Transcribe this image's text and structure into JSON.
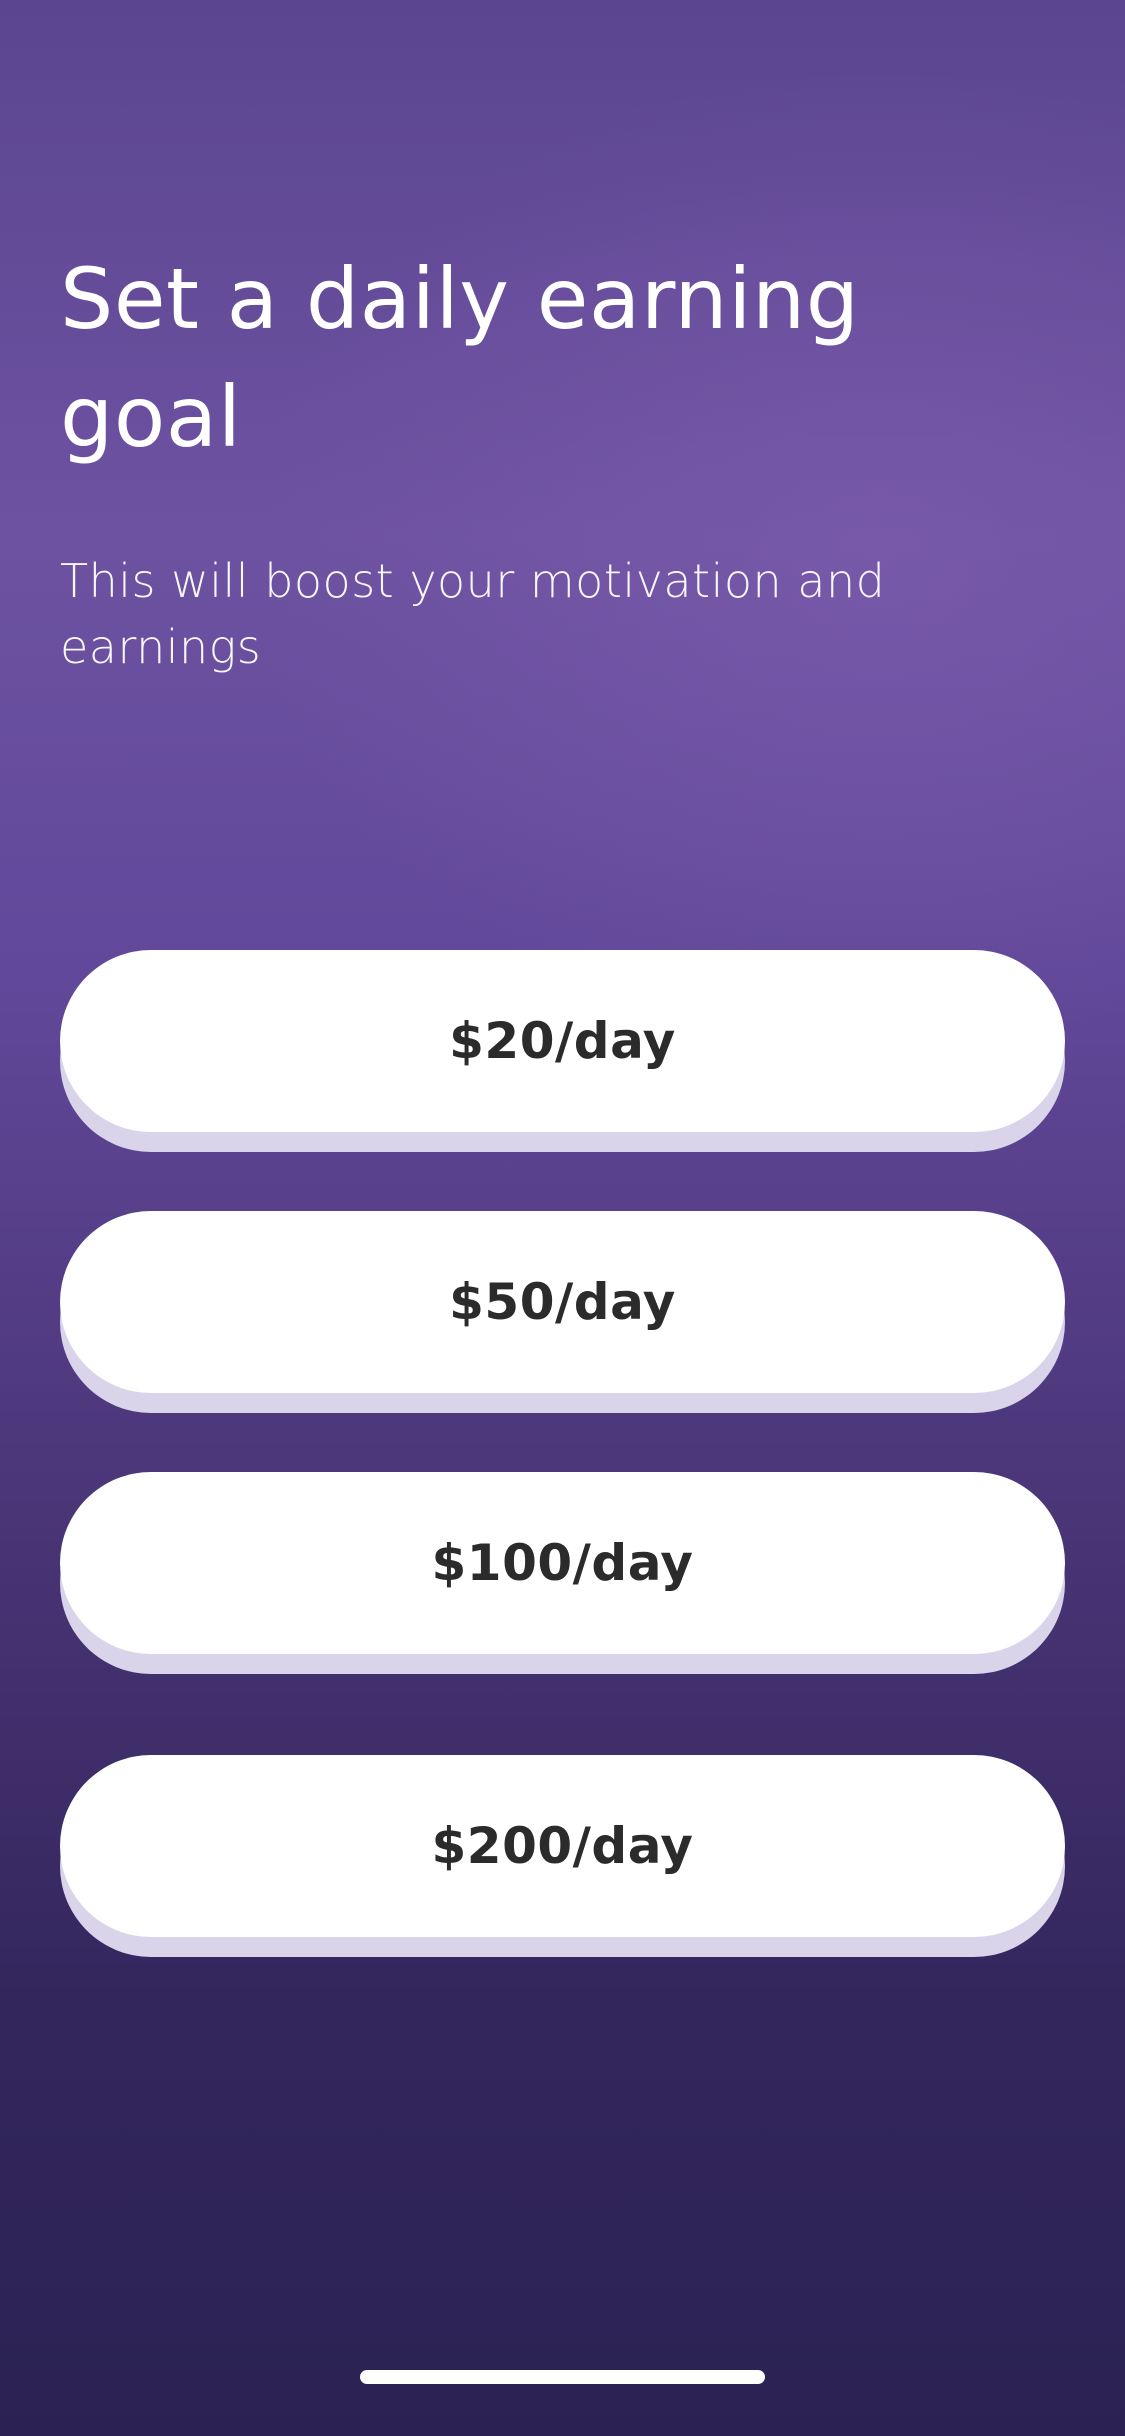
{
  "header": {
    "title": "Set a daily earning goal",
    "subtitle": "This will boost your motivation and earnings"
  },
  "options": [
    {
      "label": "$20/day"
    },
    {
      "label": "$50/day"
    },
    {
      "label": "$100/day"
    },
    {
      "label": "$200/day"
    }
  ],
  "colors": {
    "background_top": "#5b4590",
    "background_mid": "#6d52a1",
    "background_bottom": "#2b2253",
    "button_background": "#ffffff",
    "button_shadow": "#d9d4ea",
    "button_text": "#2b2b2b",
    "heading_text": "#ffffff"
  }
}
